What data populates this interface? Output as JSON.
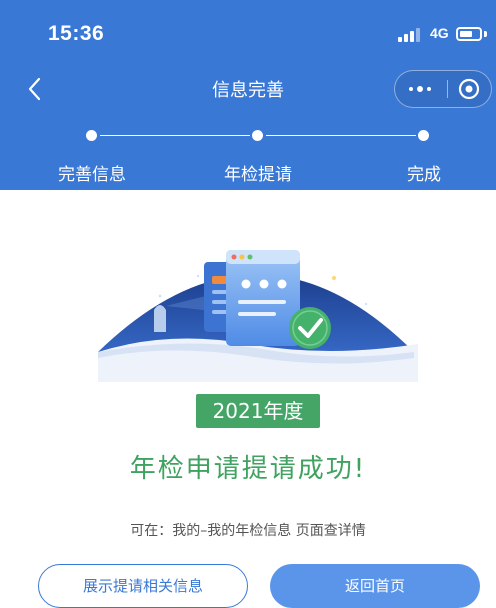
{
  "status_bar": {
    "time": "15:36",
    "network": "4G"
  },
  "nav": {
    "title": "信息完善"
  },
  "steps": [
    {
      "label": "完善信息"
    },
    {
      "label": "年检提请"
    },
    {
      "label": "完成"
    }
  ],
  "result": {
    "year_badge": "2021年度",
    "title": "年检申请提请成功!",
    "hint": "可在：我的–我的年检信息 页面查详情"
  },
  "buttons": {
    "show_info": "展示提请相关信息",
    "back_home": "返回首页"
  },
  "colors": {
    "primary": "#3a78d6",
    "success": "#44a566",
    "button": "#5b95ea"
  }
}
